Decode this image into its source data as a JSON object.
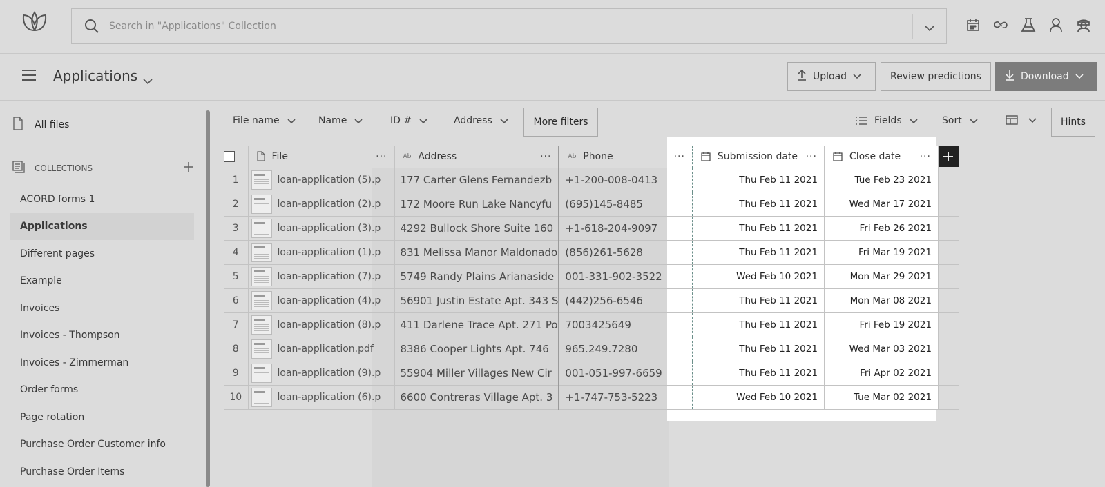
{
  "header": {
    "search_placeholder": "Search in \"Applications\" Collection",
    "icons": [
      "calendar-icon",
      "link-icon",
      "flask-icon",
      "user-icon",
      "agent-icon"
    ]
  },
  "title_row": {
    "title": "Applications",
    "upload_label": "Upload",
    "review_label": "Review predictions",
    "download_label": "Download"
  },
  "sidebar": {
    "all_files": "All files",
    "collections_heading": "COLLECTIONS",
    "items": [
      {
        "label": "ACORD forms 1"
      },
      {
        "label": "Applications"
      },
      {
        "label": "Different pages"
      },
      {
        "label": "Example"
      },
      {
        "label": "Invoices"
      },
      {
        "label": "Invoices - Thompson"
      },
      {
        "label": "Invoices - Zimmerman"
      },
      {
        "label": "Order forms"
      },
      {
        "label": "Page rotation"
      },
      {
        "label": "Purchase Order Customer info"
      },
      {
        "label": "Purchase Order Items"
      }
    ],
    "active_index": 1
  },
  "filters": {
    "file_name": "File name",
    "name": "Name",
    "id": "ID #",
    "address": "Address",
    "more_filters": "More filters",
    "fields": "Fields",
    "sort": "Sort",
    "hints": "Hints"
  },
  "table": {
    "columns": {
      "file": "File",
      "address": "Address",
      "phone": "Phone",
      "submission_date": "Submission date",
      "close_date": "Close date",
      "type_text": "Ab",
      "menu": "···"
    },
    "rows": [
      {
        "num": "1",
        "file": "loan-application (5).p",
        "address": "177 Carter Glens Fernandezb",
        "phone": "+1-200-008-0413",
        "submission": "Thu Feb 11 2021",
        "close": "Tue Feb 23 2021"
      },
      {
        "num": "2",
        "file": "loan-application (2).p",
        "address": "172 Moore Run Lake Nancyfu",
        "phone": "(695)145-8485",
        "submission": "Thu Feb 11 2021",
        "close": "Wed Mar 17 2021"
      },
      {
        "num": "3",
        "file": "loan-application (3).p",
        "address": "4292 Bullock Shore Suite 160",
        "phone": "+1-618-204-9097",
        "submission": "Thu Feb 11 2021",
        "close": "Fri Feb 26 2021"
      },
      {
        "num": "4",
        "file": "loan-application (1).p",
        "address": "831 Melissa Manor Maldonado",
        "phone": "(856)261-5628",
        "submission": "Thu Feb 11 2021",
        "close": "Fri Mar 19 2021"
      },
      {
        "num": "5",
        "file": "loan-application (7).p",
        "address": "5749 Randy Plains Arianaside",
        "phone": "001-331-902-3522",
        "submission": "Wed Feb 10 2021",
        "close": "Mon Mar 29 2021"
      },
      {
        "num": "6",
        "file": "loan-application (4).p",
        "address": "56901 Justin Estate Apt. 343 S",
        "phone": "(442)256-6546",
        "submission": "Thu Feb 11 2021",
        "close": "Mon Mar 08 2021"
      },
      {
        "num": "7",
        "file": "loan-application (8).p",
        "address": "411 Darlene Trace Apt. 271 Po",
        "phone": "7003425649",
        "submission": "Thu Feb 11 2021",
        "close": "Fri Feb 19 2021"
      },
      {
        "num": "8",
        "file": "loan-application.pdf",
        "address": "8386 Cooper Lights Apt. 746",
        "phone": "965.249.7280",
        "submission": "Thu Feb 11 2021",
        "close": "Wed Mar 03 2021"
      },
      {
        "num": "9",
        "file": "loan-application (9).p",
        "address": "55904 Miller Villages New Cir",
        "phone": "001-051-997-6659",
        "submission": "Thu Feb 11 2021",
        "close": "Fri Apr 02 2021"
      },
      {
        "num": "10",
        "file": "loan-application (6).p",
        "address": "6600 Contreras Village Apt. 3",
        "phone": "+1-747-753-5223",
        "submission": "Wed Feb 10 2021",
        "close": "Tue Mar 02 2021"
      }
    ]
  }
}
